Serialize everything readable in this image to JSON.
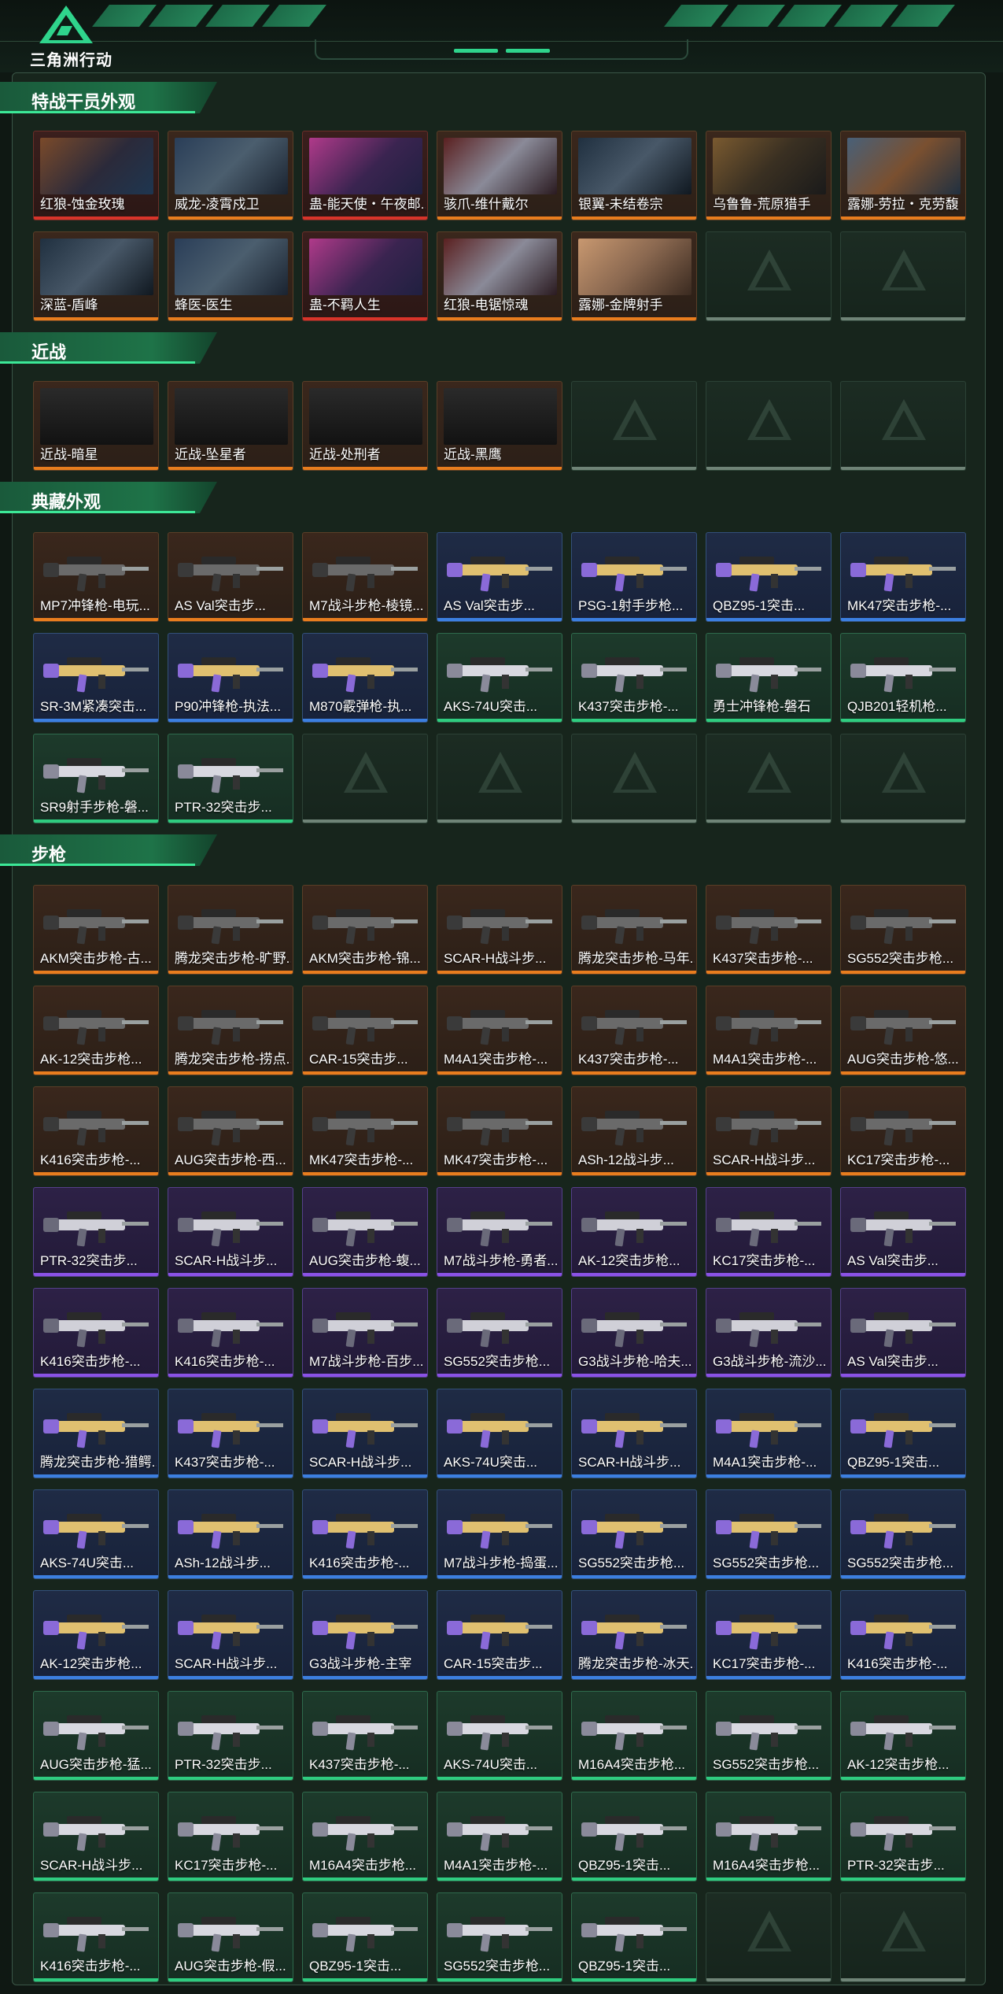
{
  "app": {
    "brand": "三角洲行动"
  },
  "colors": {
    "orange": "#e87d1e",
    "blue": "#3c7fe0",
    "purple": "#8a52e6",
    "green": "#2fcc80",
    "red": "#d8342a",
    "accent": "#3ce897"
  },
  "sections": {
    "operators": {
      "title": "特战干员外观"
    },
    "melee": {
      "title": "近战"
    },
    "collection": {
      "title": "典藏外观"
    },
    "rifles": {
      "title": "步枪"
    }
  },
  "operators": [
    "红狼-蚀金玫瑰",
    "威龙-凌霄戍卫",
    "蛊-能天使・午夜邮...",
    "骇爪-维什戴尔",
    "银翼-未结卷宗",
    "乌鲁鲁-荒原猎手",
    "露娜-劳拉・克劳馥",
    "深蓝-盾峰",
    "蜂医-医生",
    "蛊-不羁人生",
    "红狼-电锯惊魂",
    "露娜-金牌射手"
  ],
  "melee": [
    "近战-暗星",
    "近战-坠星者",
    "近战-处刑者",
    "近战-黑鹰"
  ],
  "collection": [
    "MP7冲锋枪-电玩...",
    "AS Val突击步...",
    "M7战斗步枪-棱镜...",
    "AS Val突击步...",
    "PSG-1射手步枪...",
    "QBZ95-1突击...",
    "MK47突击步枪-...",
    "SR-3M紧凑突击...",
    "P90冲锋枪-执法...",
    "M870霰弹枪-执...",
    "AKS-74U突击...",
    "K437突击步枪-...",
    "勇士冲锋枪-磐石",
    "QJB201轻机枪...",
    "SR9射手步枪-磐...",
    "PTR-32突击步..."
  ],
  "rifles": [
    "AKM突击步枪-古...",
    "腾龙突击步枪-旷野...",
    "AKM突击步枪-锦...",
    "SCAR-H战斗步...",
    "腾龙突击步枪-马年...",
    "K437突击步枪-...",
    "SG552突击步枪...",
    "AK-12突击步枪...",
    "腾龙突击步枪-捞点...",
    "CAR-15突击步...",
    "M4A1突击步枪-...",
    "K437突击步枪-...",
    "M4A1突击步枪-...",
    "AUG突击步枪-悠...",
    "K416突击步枪-...",
    "AUG突击步枪-西...",
    "MK47突击步枪-...",
    "MK47突击步枪-...",
    "ASh-12战斗步...",
    "SCAR-H战斗步...",
    "KC17突击步枪-...",
    "PTR-32突击步...",
    "SCAR-H战斗步...",
    "AUG突击步枪-蝮...",
    "M7战斗步枪-勇者...",
    "AK-12突击步枪...",
    "KC17突击步枪-...",
    "AS Val突击步...",
    "K416突击步枪-...",
    "K416突击步枪-...",
    "M7战斗步枪-百步...",
    "SG552突击步枪...",
    "G3战斗步枪-哈夫...",
    "G3战斗步枪-流沙...",
    "AS Val突击步...",
    "腾龙突击步枪-猎鳄...",
    "K437突击步枪-...",
    "SCAR-H战斗步...",
    "AKS-74U突击...",
    "SCAR-H战斗步...",
    "M4A1突击步枪-...",
    "QBZ95-1突击...",
    "AKS-74U突击...",
    "ASh-12战斗步...",
    "K416突击步枪-...",
    "M7战斗步枪-捣蛋...",
    "SG552突击步枪...",
    "SG552突击步枪...",
    "SG552突击步枪...",
    "AK-12突击步枪...",
    "SCAR-H战斗步...",
    "G3战斗步枪-主宰",
    "CAR-15突击步...",
    "腾龙突击步枪-冰天...",
    "KC17突击步枪-...",
    "K416突击步枪-...",
    "AUG突击步枪-猛...",
    "PTR-32突击步...",
    "K437突击步枪-...",
    "AKS-74U突击...",
    "M16A4突击步枪...",
    "SG552突击步枪...",
    "AK-12突击步枪...",
    "SCAR-H战斗步...",
    "KC17突击步枪-...",
    "M16A4突击步枪...",
    "M4A1突击步枪-...",
    "QBZ95-1突击...",
    "M16A4突击步枪...",
    "PTR-32突击步...",
    "K416突击步枪-...",
    "AUG突击步枪-假...",
    "QBZ95-1突击...",
    "SG552突击步枪...",
    "QBZ95-1突击..."
  ]
}
